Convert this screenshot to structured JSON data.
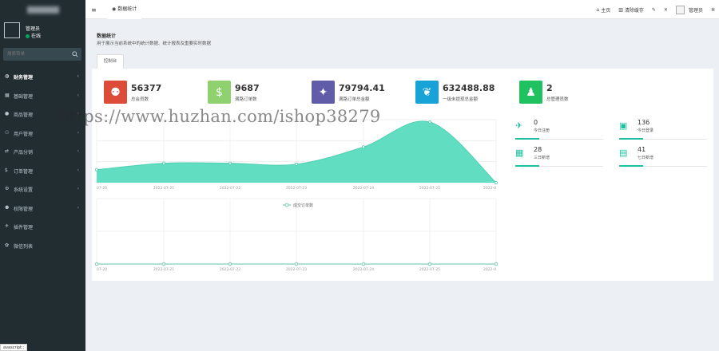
{
  "sidebar": {
    "user": {
      "name": "管理员",
      "status": "在线"
    },
    "search": {
      "placeholder": "搜索菜单"
    },
    "items": [
      {
        "label": "财务管理",
        "icon": "dashboard-icon"
      },
      {
        "label": "基础管理",
        "icon": "grid-icon"
      },
      {
        "label": "商品管理",
        "icon": "circle-icon"
      },
      {
        "label": "用户管理",
        "icon": "user-icon"
      },
      {
        "label": "产品分销",
        "icon": "share-icon"
      },
      {
        "label": "订单管理",
        "icon": "cart-icon"
      },
      {
        "label": "系统设置",
        "icon": "gear-icon"
      },
      {
        "label": "权限管理",
        "icon": "users-icon"
      },
      {
        "label": "插件管理",
        "icon": "rocket-icon"
      },
      {
        "label": "微信列表",
        "icon": "wechat-icon"
      }
    ],
    "js_tag": "avascript:;"
  },
  "header": {
    "tab": "数据统计",
    "nav": {
      "home": "主页",
      "clear_cache": "清除缓存",
      "admin": "管理员"
    }
  },
  "content": {
    "title": "数据统计",
    "subtitle": "用于展示当前系统中的统计数据、统计报表及重要实时数据",
    "panel_tab": "控制台"
  },
  "stats": [
    {
      "value": "56377",
      "label": "总会员数",
      "color": "#dd4b39",
      "icon": "users-icon"
    },
    {
      "value": "9687",
      "label": "满路订单数",
      "color": "#8fd16e",
      "icon": "dollar-icon"
    },
    {
      "value": "79794.41",
      "label": "满路订单总金额",
      "color": "#605ca8",
      "icon": "magic-icon"
    },
    {
      "value": "632488.88",
      "label": "一级未提现总金额",
      "color": "#17a2d8",
      "icon": "leaf-icon"
    },
    {
      "value": "2",
      "label": "总管理员数",
      "color": "#1fc160",
      "icon": "user-icon"
    }
  ],
  "mini_stats": [
    {
      "value": "0",
      "label": "今日注册",
      "icon": "rocket-icon"
    },
    {
      "value": "136",
      "label": "今日登录",
      "icon": "vcard-icon"
    },
    {
      "value": "28",
      "label": "三日新增",
      "icon": "calendar-icon"
    },
    {
      "value": "41",
      "label": "七日新增",
      "icon": "calendar-plus-icon"
    }
  ],
  "watermark": "https://www.huzhan.com/ishop38279",
  "chart_data": [
    {
      "type": "area",
      "x": [
        "07-20",
        "2022-07-21",
        "2022-07-22",
        "2022-07-23",
        "2022-07-24",
        "2022-07-25",
        "2022-0"
      ],
      "values": [
        12,
        18,
        18,
        17,
        33,
        56,
        0
      ],
      "color": "#59dcbf",
      "grid": true,
      "legend": "none"
    },
    {
      "type": "line",
      "series": [
        {
          "name": "成交订单数",
          "values": [
            0,
            0,
            0,
            0,
            0,
            0,
            0
          ]
        }
      ],
      "x": [
        "07-20",
        "2022-07-21",
        "2022-07-22",
        "2022-07-23",
        "2022-07-24",
        "2022-07-25",
        "2022-0"
      ],
      "color": "#5fc3a8",
      "grid": true,
      "legend": "top-center"
    }
  ]
}
